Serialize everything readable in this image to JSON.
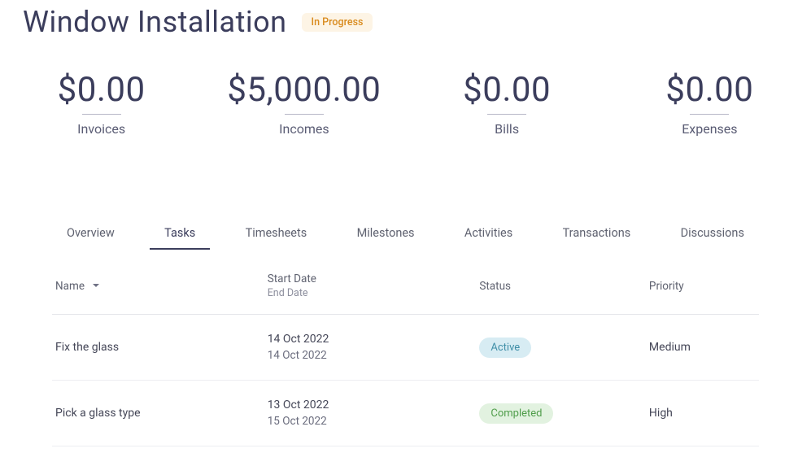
{
  "header": {
    "title": "Window Installation",
    "status_label": "In Progress"
  },
  "metrics": [
    {
      "value": "$0.00",
      "label": "Invoices"
    },
    {
      "value": "$5,000.00",
      "label": "Incomes"
    },
    {
      "value": "$0.00",
      "label": "Bills"
    },
    {
      "value": "$0.00",
      "label": "Expenses"
    }
  ],
  "tabs": [
    {
      "label": "Overview",
      "active": false
    },
    {
      "label": "Tasks",
      "active": true
    },
    {
      "label": "Timesheets",
      "active": false
    },
    {
      "label": "Milestones",
      "active": false
    },
    {
      "label": "Activities",
      "active": false
    },
    {
      "label": "Transactions",
      "active": false
    },
    {
      "label": "Discussions",
      "active": false
    }
  ],
  "table": {
    "columns": {
      "name": "Name",
      "start_date": "Start Date",
      "end_date": "End Date",
      "status": "Status",
      "priority": "Priority"
    },
    "rows": [
      {
        "name": "Fix the glass",
        "start_date": "14 Oct 2022",
        "end_date": "14 Oct 2022",
        "status": {
          "label": "Active",
          "class": "badge-active"
        },
        "priority": "Medium"
      },
      {
        "name": "Pick a glass type",
        "start_date": "13 Oct 2022",
        "end_date": "15 Oct 2022",
        "status": {
          "label": "Completed",
          "class": "badge-completed"
        },
        "priority": "High"
      }
    ]
  }
}
